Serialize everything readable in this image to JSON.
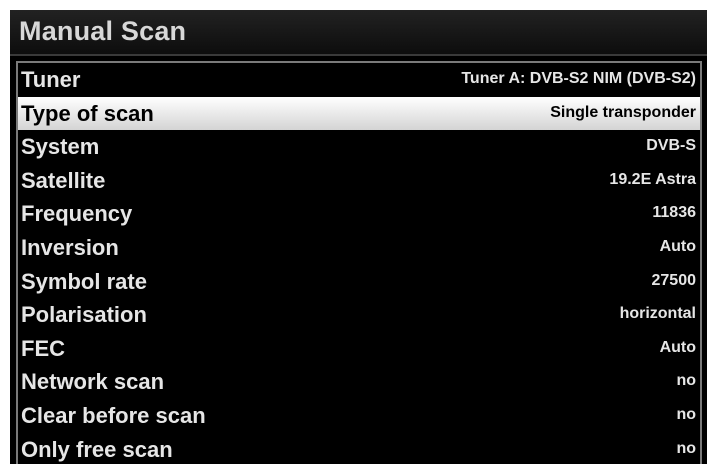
{
  "header": {
    "title": "Manual Scan"
  },
  "menu": {
    "selected_index": 1,
    "items": [
      {
        "label": "Tuner",
        "value": "Tuner A: DVB-S2 NIM (DVB-S2)"
      },
      {
        "label": "Type of scan",
        "value": "Single transponder"
      },
      {
        "label": "System",
        "value": "DVB-S"
      },
      {
        "label": "Satellite",
        "value": "19.2E Astra"
      },
      {
        "label": "Frequency",
        "value": "11836"
      },
      {
        "label": "Inversion",
        "value": "Auto"
      },
      {
        "label": "Symbol rate",
        "value": "27500"
      },
      {
        "label": "Polarisation",
        "value": "horizontal"
      },
      {
        "label": "FEC",
        "value": "Auto"
      },
      {
        "label": "Network scan",
        "value": "no"
      },
      {
        "label": "Clear before scan",
        "value": "no"
      },
      {
        "label": "Only free scan",
        "value": "no"
      }
    ]
  },
  "colors": {
    "background": "#000000",
    "text": "#e6e6e6",
    "selection_bg": "#f0f0f0",
    "selection_text": "#000000",
    "frame_border": "#7a7a7a"
  }
}
